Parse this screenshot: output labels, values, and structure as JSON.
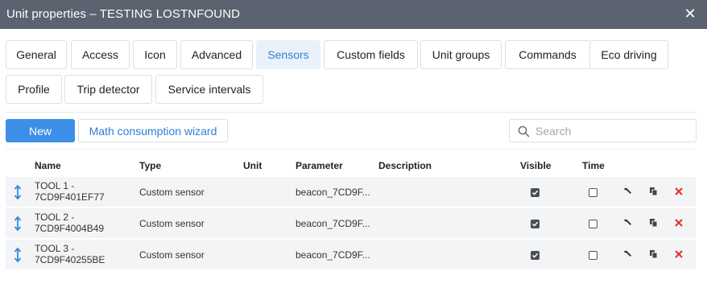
{
  "window": {
    "title": "Unit properties – TESTING LOSTNFOUND",
    "close_glyph": "✕"
  },
  "tabs": [
    {
      "label": "General",
      "active": false
    },
    {
      "label": "Access",
      "active": false
    },
    {
      "label": "Icon",
      "active": false
    },
    {
      "label": "Advanced",
      "active": false
    },
    {
      "label": "Sensors",
      "active": true
    },
    {
      "label": "Custom fields",
      "active": false
    },
    {
      "label": "Unit groups",
      "active": false
    },
    {
      "label": "Commands",
      "active": false
    },
    {
      "label": "Eco driving",
      "active": false
    },
    {
      "label": "Profile",
      "active": false
    },
    {
      "label": "Trip detector",
      "active": false
    },
    {
      "label": "Service intervals",
      "active": false
    }
  ],
  "toolbar": {
    "new_label": "New",
    "wizard_label": "Math consumption wizard",
    "search_placeholder": "Search",
    "search_value": ""
  },
  "table": {
    "headers": {
      "name": "Name",
      "type": "Type",
      "unit": "Unit",
      "parameter": "Parameter",
      "description": "Description",
      "visible": "Visible",
      "time": "Time"
    },
    "rows": [
      {
        "name_line1": "TOOL 1 -",
        "name_line2": "7CD9F401EF77",
        "type": "Custom sensor",
        "unit": "",
        "parameter": "beacon_7CD9F...",
        "description": "",
        "visible": true,
        "time": false
      },
      {
        "name_line1": "TOOL 2 -",
        "name_line2": "7CD9F4004B49",
        "type": "Custom sensor",
        "unit": "",
        "parameter": "beacon_7CD9F...",
        "description": "",
        "visible": true,
        "time": false
      },
      {
        "name_line1": "TOOL 3 -",
        "name_line2": "7CD9F40255BE",
        "type": "Custom sensor",
        "unit": "",
        "parameter": "beacon_7CD9F...",
        "description": "",
        "visible": true,
        "time": false
      }
    ]
  },
  "colors": {
    "titlebar": "#5b6270",
    "accent": "#3d8ee6",
    "active_tab_bg": "#e9f2fb",
    "delete": "#e0322b",
    "drag_handle": "#2f8be0"
  },
  "icons": {
    "drag": "drag-handle-icon",
    "edit": "wrench-icon",
    "copy": "copy-icon",
    "delete": "delete-icon",
    "search": "search-icon"
  }
}
